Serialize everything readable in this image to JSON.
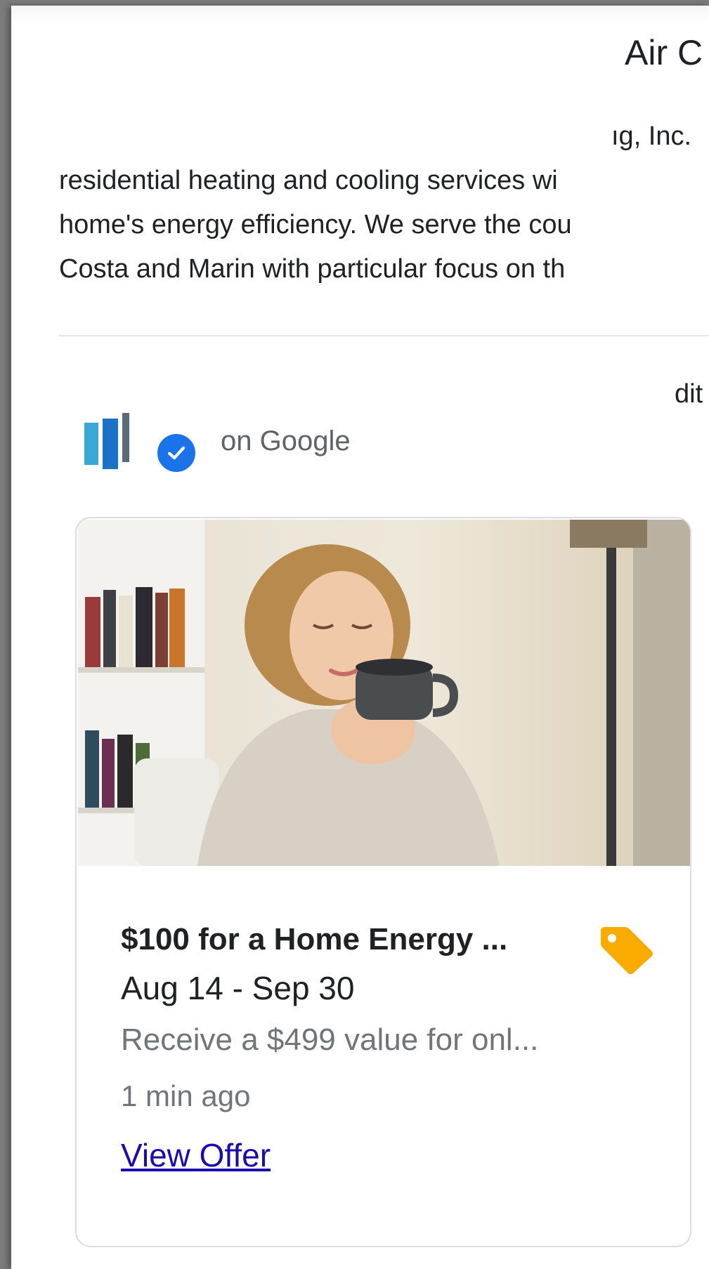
{
  "panel": {
    "title": "Air C",
    "description_lines": [
      "ıg, Inc.",
      "residential heating and cooling services wi",
      "home's energy efficiency. We serve the cou",
      "Costa and Marin with particular focus on th"
    ],
    "partial_section_text": "dit"
  },
  "posts": {
    "source_label": "on Google",
    "card": {
      "title": "$100 for a Home Energy ...",
      "dates": "Aug 14 - Sep 30",
      "description": "Receive a $499 value for onl...",
      "posted": "1 min ago",
      "link": "View Offer"
    }
  },
  "colors": {
    "tag_icon": "#f9ab00",
    "verified_badge": "#1a73e8",
    "link": "#1a0dab"
  },
  "icons": {
    "verified": "check-circle",
    "offer": "tag"
  }
}
